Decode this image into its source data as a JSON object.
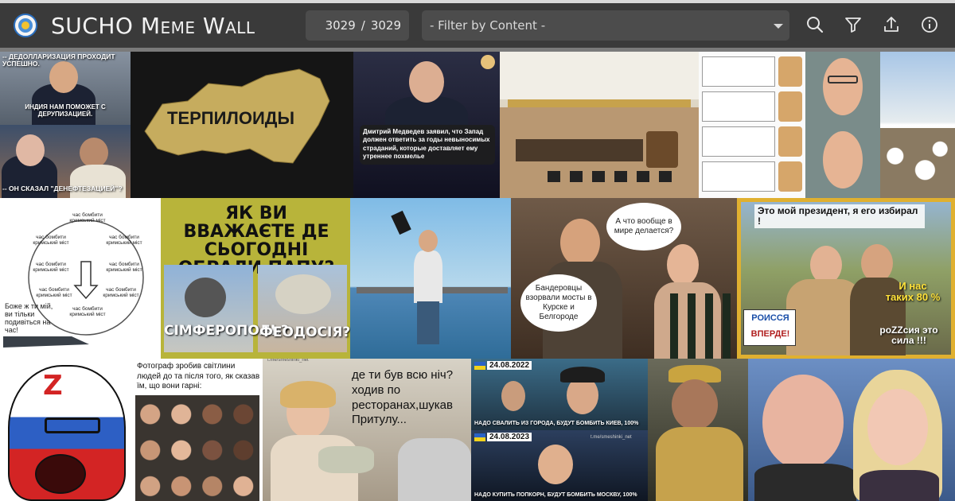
{
  "app": {
    "title": "SUCHO Meme Wall",
    "counter_current": "3029",
    "counter_separator": "/",
    "counter_total": "3029",
    "filter_placeholder": "- Filter by Content -"
  },
  "toolbar_icons": [
    "search-icon",
    "filter-icon",
    "upload-icon",
    "info-icon"
  ],
  "tiles": {
    "t1_top": "-- ДЕДОЛЛАРИЗАЦИЯ ПРОХОДИТ УСПЕШНО.",
    "t1_mid": "ИНДИЯ НАМ ПОМОЖЕТ С ДЕРУПИЗАЦИЕЙ.",
    "t1_bottom": "-- ОН СКАЗАЛ \"ДЕНЕФТЕЗАЦИЕЙ\"?",
    "t2_map": "ТЕРПИЛОИДЫ",
    "t3_caption": "Дмитрий Медведев заявил, что Запад должен ответить за годы невыносимых страданий, которые доставляет ему утреннее похмелье",
    "t6_item": "час бомбити кримський міст",
    "t6_caption": "Боже ж ти мій, ви тільки подивіться на час!",
    "t7_title": "ЯК ВИ ВВАЖАЄТЕ ДЕ СЬОГОДНІ ОБРАЛИ ПАПУ?",
    "t7_left": "СІМФЕРОПОЛЬ?",
    "t7_right": "ФЕОДОСІЯ?",
    "t9_bubble1": "А что вообще в мире делается?",
    "t9_bubble2": "Бандеровцы взорвали мосты в Курске и Белгороде",
    "t10_top": "Это мой президент, я его избирал !",
    "t10_right": "И нас таких 80 %",
    "t10_sign1": "РОИССЯ",
    "t10_sign2": "ВПЕРДЕ!",
    "t10_bottom": "роZZсия это сила !!!",
    "t12_caption": "Фотограф зробив світлини людей до та після того, як сказав їм, що вони гарні:",
    "t13_caption": "де ти був всю ніч? ходив по ресторанах,шукав Притулу...",
    "t14_date1": "24.08.2022",
    "t14_text1": "НАДО СВАЛИТЬ ИЗ ГОРОДА, БУДУТ БОМБИТЬ КИЕВ, 100%",
    "t14_date2": "24.08.2023",
    "t14_text2": "НАДО КУПИТЬ ПОПКОРН, БУДУТ БОМБИТЬ МОСКВУ, 100%",
    "watermark": "t.me/smeshinki_net"
  },
  "colors": {
    "header_bg": "#3a3a3a",
    "control_bg": "#4c4c4c",
    "yellow_frame": "#e0b030",
    "olive_bg": "#b8b43a"
  }
}
